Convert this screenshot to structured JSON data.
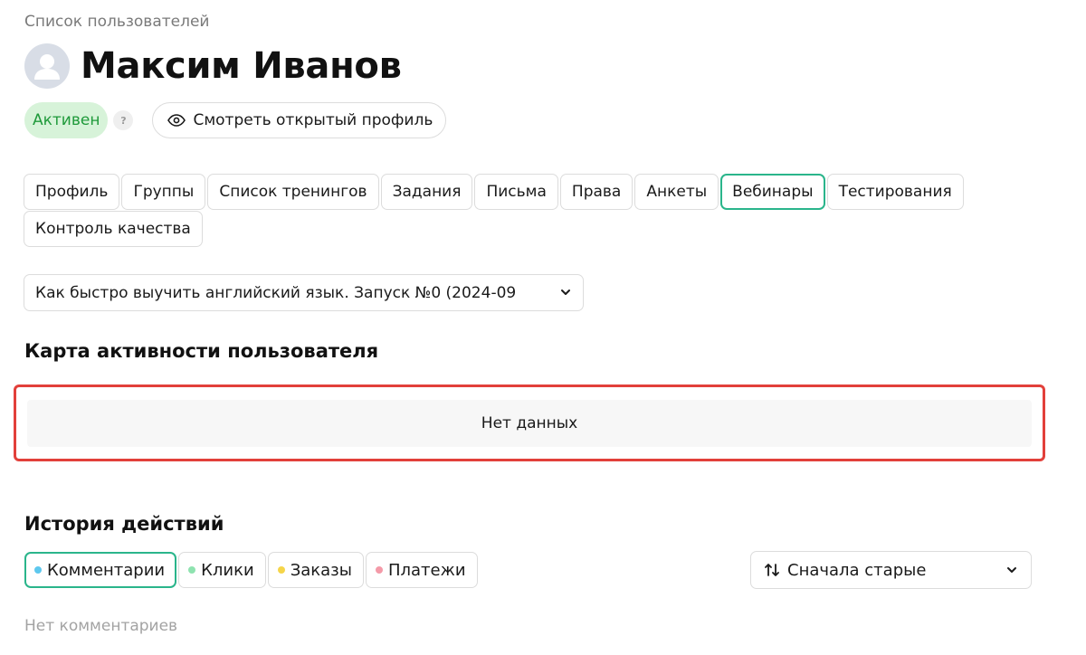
{
  "breadcrumb": "Список пользователей",
  "user": {
    "name": "Максим Иванов",
    "status": "Активен",
    "help": "?",
    "profile_link": "Смотреть открытый профиль"
  },
  "tabs": [
    {
      "label": "Профиль",
      "active": false
    },
    {
      "label": "Группы",
      "active": false
    },
    {
      "label": "Список тренингов",
      "active": false
    },
    {
      "label": "Задания",
      "active": false
    },
    {
      "label": "Письма",
      "active": false
    },
    {
      "label": "Права",
      "active": false
    },
    {
      "label": "Анкеты",
      "active": false
    },
    {
      "label": "Вебинары",
      "active": true
    },
    {
      "label": "Тестирования",
      "active": false
    },
    {
      "label": "Контроль качества",
      "active": false
    }
  ],
  "webinar_select": {
    "value": "Как быстро выучить английский язык. Запуск №0 (2024-09"
  },
  "activity": {
    "title": "Карта активности пользователя",
    "empty": "Нет данных"
  },
  "history": {
    "title": "История действий",
    "filters": [
      {
        "label": "Комментарии",
        "color": "#5ec8ee",
        "active": true
      },
      {
        "label": "Клики",
        "color": "#8fe3b0",
        "active": false
      },
      {
        "label": "Заказы",
        "color": "#f5d54a",
        "active": false
      },
      {
        "label": "Платежи",
        "color": "#f49aa8",
        "active": false
      }
    ],
    "sort": "Сначала старые",
    "empty": "Нет комментариев"
  },
  "colors": {
    "accent": "#2ab58b",
    "status_bg": "#d7f3d9",
    "status_text": "#1f9a3a",
    "highlight": "#e2403a"
  }
}
